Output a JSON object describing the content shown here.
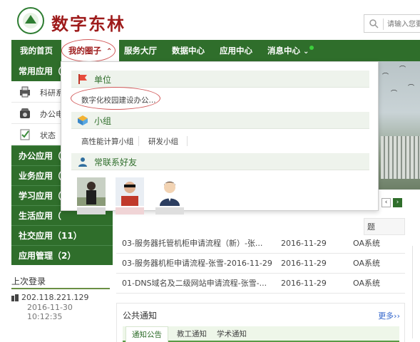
{
  "brand": {
    "name": "数字东林"
  },
  "search": {
    "placeholder": "请输入您要"
  },
  "nav": {
    "items": [
      "我的首页",
      "我的圈子",
      "服务大厅",
      "数据中心",
      "应用中心",
      "消息中心"
    ],
    "active_index": 1,
    "circle_arrow": "^",
    "msg_arrow": "v"
  },
  "sidebar": {
    "header": "常用应用（",
    "rows": [
      {
        "label": "科研系",
        "icon": "printer-icon"
      },
      {
        "label": "办公电",
        "icon": "telephone-icon"
      },
      {
        "label": "状态",
        "icon": "checklist-icon"
      }
    ],
    "groups": [
      "办公应用（",
      "业务应用（",
      "学习应用（",
      "生活应用（",
      "社交应用（11）",
      "应用管理（2）"
    ]
  },
  "last_login": {
    "title": "上次登录",
    "ip": "202.118.221.129",
    "time": "2016-11-30 10:12:35"
  },
  "dropdown": {
    "unit": {
      "title": "单位",
      "items": [
        "数字化校园建设办公..."
      ]
    },
    "group": {
      "title": "小组",
      "items": [
        "高性能计算小组",
        "研发小组"
      ]
    },
    "friends": {
      "title": "常联系好友",
      "count": 3
    }
  },
  "table": {
    "header_fragment": "题",
    "rows": [
      {
        "title": "03-服务器托管机柜申请流程（新）-张...",
        "date": "2016-11-29",
        "system": "OA系统"
      },
      {
        "title": "03-服务器机柜申请流程-张雪-2016-11-29",
        "date": "2016-11-29",
        "system": "OA系统"
      },
      {
        "title": "01-DNS域名及二级网站申请流程-张雪-...",
        "date": "2016-11-29",
        "system": "OA系统"
      }
    ]
  },
  "notice": {
    "title": "公共通知",
    "more": "更多››",
    "tabs": [
      "通知公告",
      "教工通知",
      "学术通知"
    ]
  },
  "colors": {
    "nav_green": "#2f6e2b",
    "brand_red": "#9e1b1b",
    "oval_red": "#d25a5a"
  }
}
